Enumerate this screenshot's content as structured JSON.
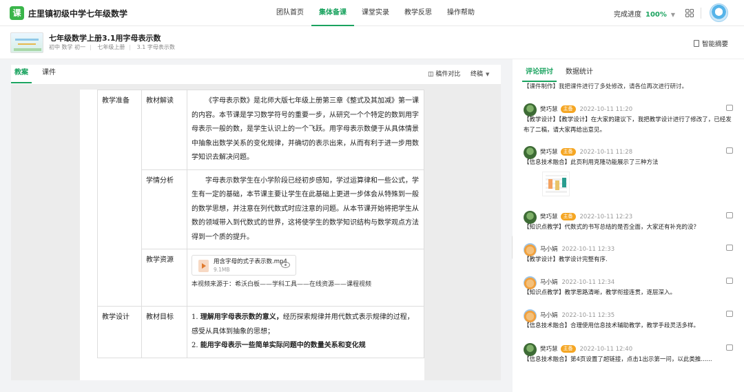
{
  "app": {
    "logo_char": "课",
    "name": "庄里镇初级中学七年级数学"
  },
  "nav": {
    "items": [
      "团队首页",
      "集体备课",
      "课堂实录",
      "教学反思",
      "操作帮助"
    ],
    "active_index": 1
  },
  "progress": {
    "label": "完成进度",
    "value": "100%"
  },
  "doc": {
    "title": "七年级数学上册3.1用字母表示数",
    "meta": [
      "初中 数学 初一",
      "七年级上册",
      "3.1 字母表示数"
    ],
    "summary_label": "智能摘要"
  },
  "left_tabs": {
    "items": [
      "教案",
      "课件"
    ],
    "active_index": 0
  },
  "toolbar": {
    "compare_label": "稿件对比",
    "version_label": "终稿"
  },
  "plan": {
    "sections": [
      {
        "category": "教学准备",
        "label": "教材解读",
        "text": "《字母表示数》是北师大版七年级上册第三章《整式及其加减》第一课的内容。本节课是学习数学符号的重要一步，从研究一个个特定的数到用字母表示一般的数，是学生认识上的一个飞跃。用字母表示数便于从具体情景中抽象出数学关系的变化规律，并确切的表示出来，从而有利于进一步用数学知识去解决问题。"
      },
      {
        "category": "",
        "label": "学情分析",
        "text": "字母表示数学生在小学阶段已经初步感知，学过运算律和一些公式，学生有一定的基础，本节课主要让学生在此基础上更进一步体会从特殊到一般的数学思想，并注意在列代数式时应注意的问题。从本节课开始将把学生从数的领域带入到代数式的世界，这将使学生的数学知识结构与数学观点方法得到一个质的提升。"
      },
      {
        "category": "",
        "label": "教学资源",
        "resource": {
          "name": "用含字母的式子表示数.mp4",
          "size": "9.1MB"
        },
        "source": "本视频来源于：希沃白板——学科工具——在线资源——课程视频"
      },
      {
        "category": "教学设计",
        "label": "教材目标",
        "objectives": [
          {
            "num": "1.",
            "bold": "理解用字母表示数的意义，",
            "rest": "经历探索规律并用代数式表示规律的过程，感受从具体到抽象的思想；"
          },
          {
            "num": "2.",
            "bold": "能用字母表示一些简单实际问题中的数量关系和变化规",
            "rest": ""
          }
        ]
      }
    ]
  },
  "right_tabs": {
    "items": [
      "评论研讨",
      "数据统计"
    ],
    "active_index": 0
  },
  "comments": {
    "cut_text": "【课件制作】我把课件进行了多处修改，请各位再次进行研讨。",
    "items": [
      {
        "author": "樊巧慧",
        "badge": "主备",
        "time": "2022-10-11 11:20",
        "text": "【教学设计】【教学设计】在大家的建议下，我把教学设计进行了修改了，已经发布了二稿，请大家再给出意见。",
        "avatar": "green"
      },
      {
        "author": "樊巧慧",
        "badge": "主备",
        "time": "2022-10-11 11:28",
        "text": "【信息技术融合】此页利用克隆功能展示了三种方法",
        "avatar": "green",
        "image": true
      },
      {
        "author": "樊巧慧",
        "badge": "主备",
        "time": "2022-10-11 12:23",
        "text": "【知识点教学】代数式的书写总结的是否全面，大家还有补充的没？",
        "avatar": "green"
      },
      {
        "author": "马小娟",
        "badge": "",
        "time": "2022-10-11 12:33",
        "text": "【教学设计】教学设计完整有序.",
        "avatar": "cat"
      },
      {
        "author": "马小娟",
        "badge": "",
        "time": "2022-10-11 12:34",
        "text": "【知识点教学】教学思路清晰，教学衔接连贯，逐层深入。",
        "avatar": "cat"
      },
      {
        "author": "马小娟",
        "badge": "",
        "time": "2022-10-11 12:35",
        "text": "【信息技术融合】合理使用信息技术辅助教学，教学手段灵活多样。",
        "avatar": "cat"
      },
      {
        "author": "樊巧慧",
        "badge": "主备",
        "time": "2022-10-11 12:40",
        "text": "【信息技术融合】第4页设置了超链接，点击1出示第一问，以此类推......",
        "avatar": "green"
      }
    ]
  }
}
